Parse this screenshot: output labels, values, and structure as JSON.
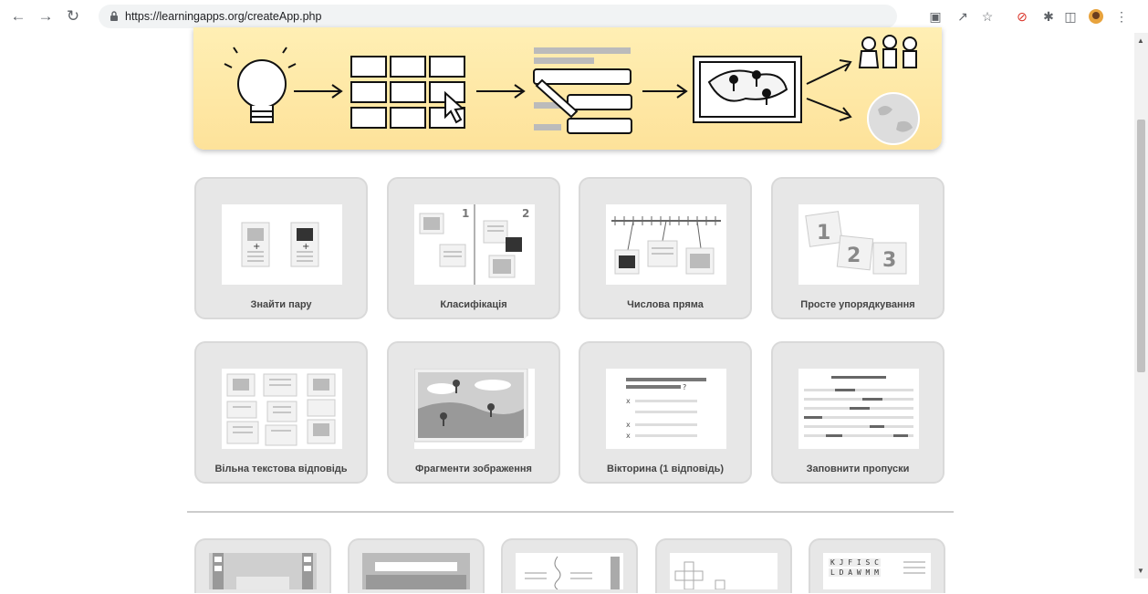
{
  "browser": {
    "url": "https://learningapps.org/createApp.php"
  },
  "apps_row1": [
    {
      "label": "Знайти пару",
      "icon": "pair-matching-icon"
    },
    {
      "label": "Класифікація",
      "icon": "classification-icon"
    },
    {
      "label": "Числова пряма",
      "icon": "number-line-icon"
    },
    {
      "label": "Просте упорядкування",
      "icon": "ordering-icon"
    }
  ],
  "apps_row2": [
    {
      "label": "Вільна текстова відповідь",
      "icon": "free-text-icon"
    },
    {
      "label": "Фрагменти зображення",
      "icon": "image-fragments-icon"
    },
    {
      "label": "Вікторина (1 відповідь)",
      "icon": "quiz-icon"
    },
    {
      "label": "Заповнити пропуски",
      "icon": "fill-blanks-icon"
    }
  ],
  "apps_row3": [
    {
      "icon": "video-icon"
    },
    {
      "icon": "audio-icon"
    },
    {
      "icon": "puzzle-icon"
    },
    {
      "icon": "crossword-icon"
    },
    {
      "icon": "word-grid-icon",
      "letters": [
        "K J F I S C",
        "L D A W M M"
      ]
    }
  ]
}
